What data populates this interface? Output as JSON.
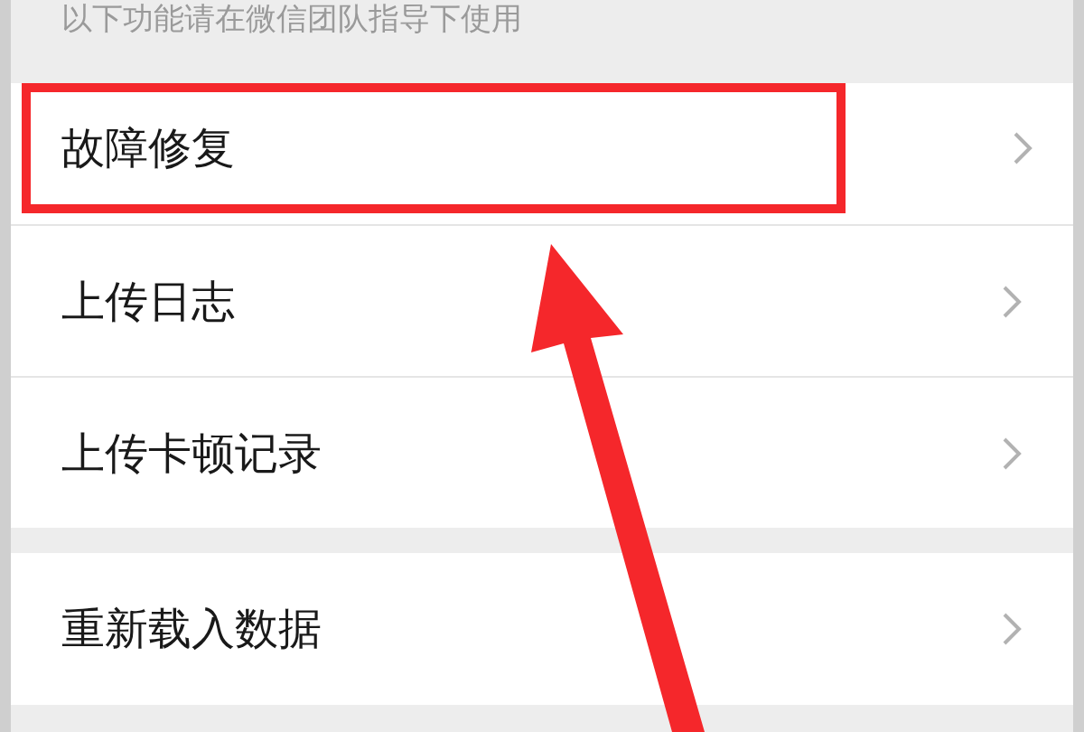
{
  "notice": "以下功能请在微信团队指导下使用",
  "groups": [
    {
      "items": [
        {
          "label": "故障修复",
          "highlighted": true
        },
        {
          "label": "上传日志",
          "highlighted": false
        },
        {
          "label": "上传卡顿记录",
          "highlighted": false
        }
      ]
    },
    {
      "items": [
        {
          "label": "重新载入数据",
          "highlighted": false
        }
      ]
    }
  ],
  "annotations": [
    {
      "kind": "arrow"
    }
  ]
}
